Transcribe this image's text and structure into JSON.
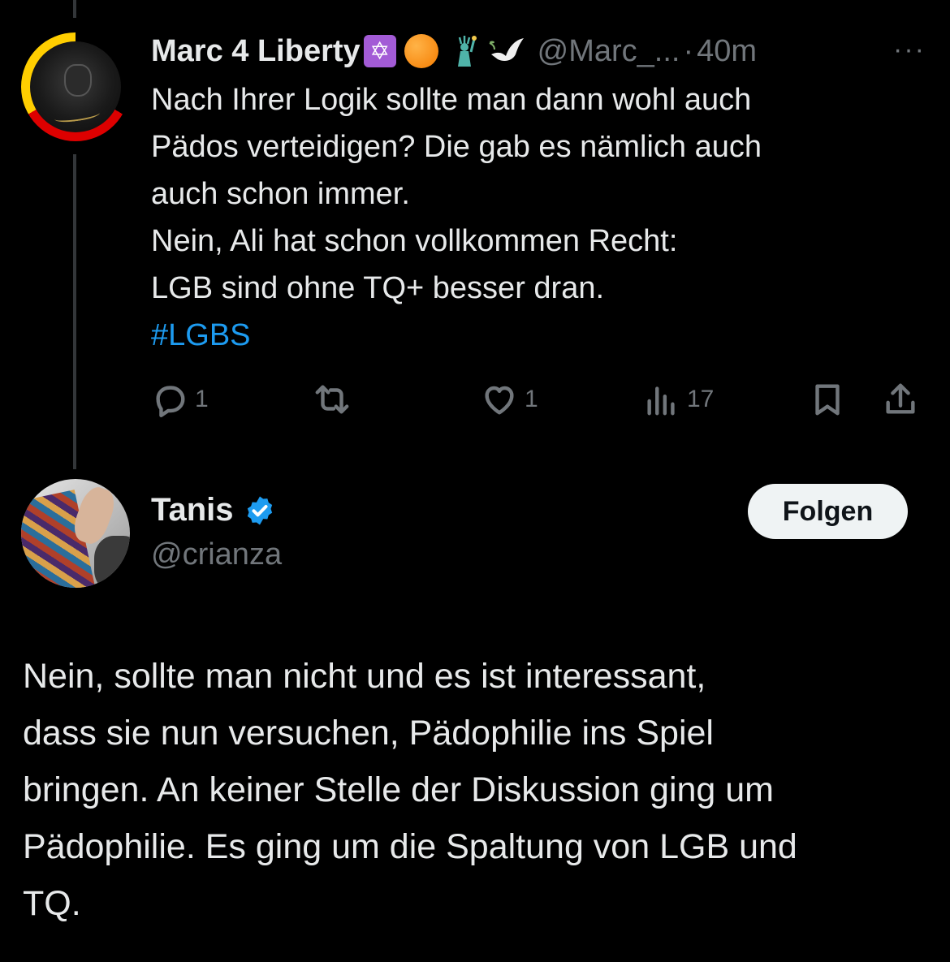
{
  "post1": {
    "display_name": "Marc 4 Liberty",
    "name_emojis": [
      "star-of-david-emoji",
      "orange-circle-emoji",
      "statue-of-liberty-emoji",
      "dove-emoji"
    ],
    "handle": "@Marc_...",
    "separator": "·",
    "time": "40m",
    "more": "···",
    "lines": [
      "Nach Ihrer Logik sollte man dann wohl auch",
      "Pädos verteidigen? Die gab es nämlich auch",
      "auch schon immer.",
      "Nein, Ali hat schon vollkommen Recht:",
      "LGB sind ohne TQ+ besser dran."
    ],
    "hashtag": "#LGBS",
    "actions": {
      "replies": "1",
      "reposts": "",
      "likes": "1",
      "views": "17"
    }
  },
  "post2": {
    "display_name": "Tanis",
    "handle": "@crianza",
    "follow_label": "Folgen",
    "lines": [
      "Nein, sollte man nicht und es ist interessant,",
      "dass sie nun versuchen, Pädophilie ins Spiel",
      "bringen. An keiner Stelle der Diskussion ging um",
      "Pädophilie. Es ging um die Spaltung von LGB und",
      "TQ."
    ]
  },
  "colors": {
    "background": "#000000",
    "text": "#e7e9ea",
    "muted": "#71767b",
    "link": "#1d9bf0",
    "verified": "#1d9bf0"
  }
}
